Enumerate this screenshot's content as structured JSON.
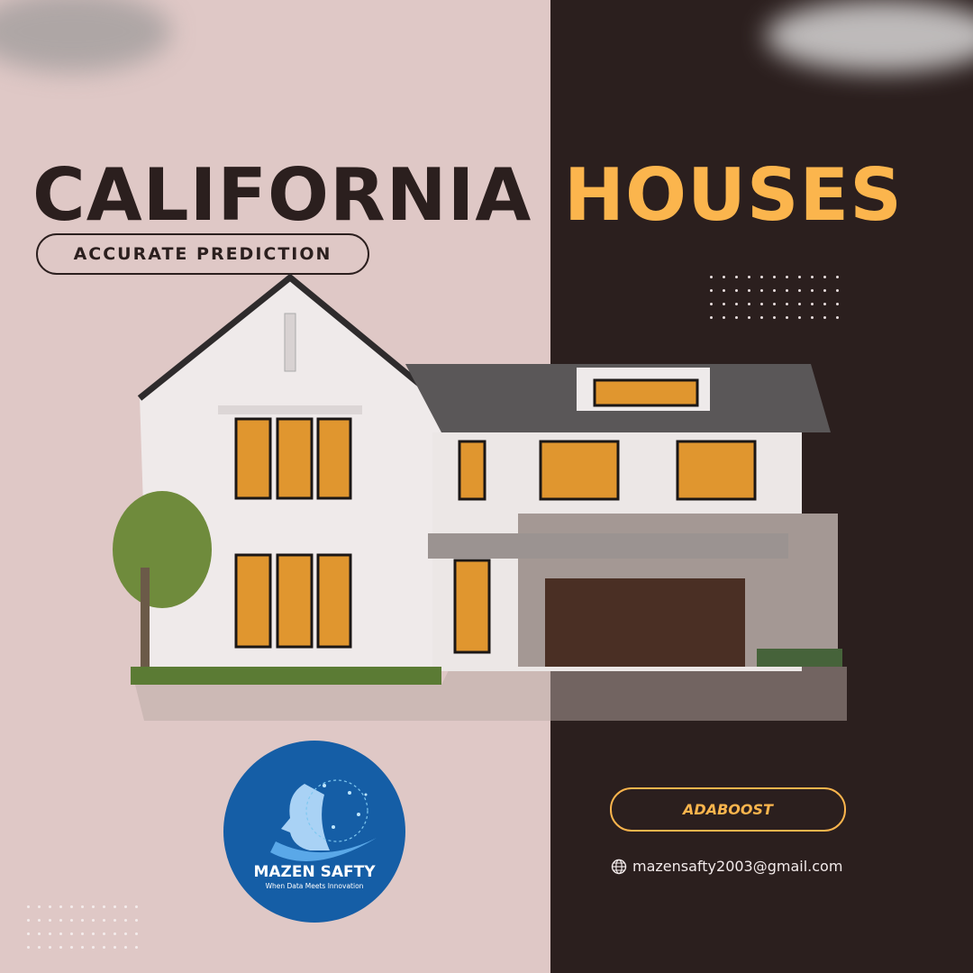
{
  "title": {
    "word1": "CALIFORNIA",
    "word2": "HOUSES"
  },
  "subtitle_pill": "ACCURATE PREDICTION",
  "model_pill": "ADABOOST",
  "contact": {
    "icon": "globe-icon",
    "email": "mazensafty2003@gmail.com"
  },
  "logo": {
    "name": "MAZEN SAFTY",
    "tagline": "When Data Meets Innovation"
  },
  "colors": {
    "left_bg": "#dfc8c6",
    "right_bg": "#2b1f1e",
    "accent": "#fbb54d",
    "logo_blue": "#155ea6"
  }
}
